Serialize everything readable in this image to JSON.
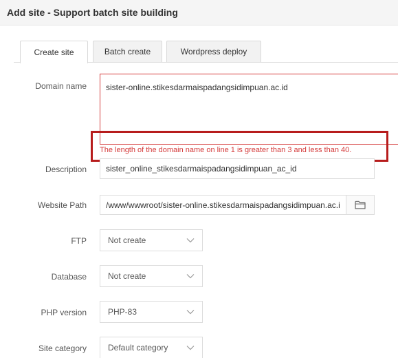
{
  "dialog": {
    "title": "Add site - Support batch site building"
  },
  "tabs": [
    {
      "label": "Create site",
      "active": true
    },
    {
      "label": "Batch create",
      "active": false
    },
    {
      "label": "Wordpress deploy",
      "active": false
    }
  ],
  "form": {
    "domain": {
      "label": "Domain name",
      "value": "sister-online.stikesdarmaispadangsidimpuan.ac.id",
      "error": "The length of the domain name on line 1 is greater than 3 and less than 40."
    },
    "description": {
      "label": "Description",
      "value": "sister_online_stikesdarmaispadangsidimpuan_ac_id"
    },
    "website_path": {
      "label": "Website Path",
      "value": "/www/wwwroot/sister-online.stikesdarmaispadangsidimpuan.ac.i",
      "button_icon": "folder-icon"
    },
    "ftp": {
      "label": "FTP",
      "selected": "Not create"
    },
    "database": {
      "label": "Database",
      "selected": "Not create"
    },
    "php_version": {
      "label": "PHP version",
      "selected": "PHP-83"
    },
    "site_category": {
      "label": "Site category",
      "selected": "Default category"
    }
  },
  "colors": {
    "error": "#d43a3a",
    "highlight_border": "#b71c1c",
    "border": "#dcdcdc",
    "title_bg": "#f5f5f5"
  }
}
